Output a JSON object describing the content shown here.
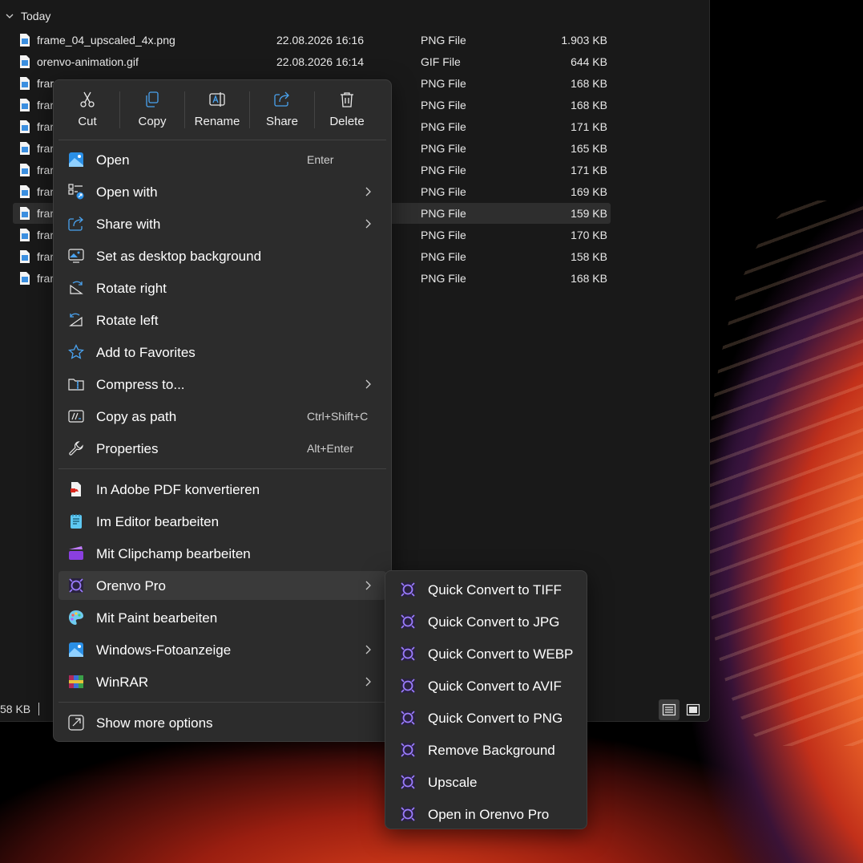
{
  "explorer": {
    "group_label": "Today",
    "files": [
      {
        "name": "frame_04_upscaled_4x.png",
        "date": "22.08.2026 16:16",
        "type": "PNG File",
        "size": "1.903 KB"
      },
      {
        "name": "orenvo-animation.gif",
        "date": "22.08.2026 16:14",
        "type": "GIF File",
        "size": "644 KB"
      },
      {
        "name": "frar",
        "date": "",
        "type": "PNG File",
        "size": "168 KB"
      },
      {
        "name": "frar",
        "date": "",
        "type": "PNG File",
        "size": "168 KB"
      },
      {
        "name": "frar",
        "date": "",
        "type": "PNG File",
        "size": "171 KB"
      },
      {
        "name": "frar",
        "date": "",
        "type": "PNG File",
        "size": "165 KB"
      },
      {
        "name": "frar",
        "date": "",
        "type": "PNG File",
        "size": "171 KB"
      },
      {
        "name": "frar",
        "date": "",
        "type": "PNG File",
        "size": "169 KB"
      },
      {
        "name": "frar",
        "date": "",
        "type": "PNG File",
        "size": "159 KB"
      },
      {
        "name": "frar",
        "date": "",
        "type": "PNG File",
        "size": "170 KB"
      },
      {
        "name": "frar",
        "date": "",
        "type": "PNG File",
        "size": "158 KB"
      },
      {
        "name": "frar",
        "date": "",
        "type": "PNG File",
        "size": "168 KB"
      }
    ],
    "status_size": "58 KB"
  },
  "context_menu": {
    "quick_actions": {
      "cut": "Cut",
      "copy": "Copy",
      "rename": "Rename",
      "share": "Share",
      "delete": "Delete"
    },
    "items": [
      {
        "label": "Open",
        "shortcut": "Enter"
      },
      {
        "label": "Open with",
        "shortcut": ""
      },
      {
        "label": "Share with",
        "shortcut": ""
      },
      {
        "label": "Set as desktop background",
        "shortcut": ""
      },
      {
        "label": "Rotate right",
        "shortcut": ""
      },
      {
        "label": "Rotate left",
        "shortcut": ""
      },
      {
        "label": "Add to Favorites",
        "shortcut": ""
      },
      {
        "label": "Compress to...",
        "shortcut": ""
      },
      {
        "label": "Copy as path",
        "shortcut": "Ctrl+Shift+C"
      },
      {
        "label": "Properties",
        "shortcut": "Alt+Enter"
      },
      {
        "label": "In Adobe PDF konvertieren",
        "shortcut": ""
      },
      {
        "label": "Im Editor bearbeiten",
        "shortcut": ""
      },
      {
        "label": "Mit Clipchamp bearbeiten",
        "shortcut": ""
      },
      {
        "label": "Orenvo Pro",
        "shortcut": ""
      },
      {
        "label": "Mit Paint bearbeiten",
        "shortcut": ""
      },
      {
        "label": "Windows-Fotoanzeige",
        "shortcut": ""
      },
      {
        "label": "WinRAR",
        "shortcut": ""
      },
      {
        "label": "Show more options",
        "shortcut": ""
      }
    ]
  },
  "submenu": {
    "items": [
      "Quick Convert to TIFF",
      "Quick Convert to JPG",
      "Quick Convert to WEBP",
      "Quick Convert to AVIF",
      "Quick Convert to PNG",
      "Remove Background",
      "Upscale",
      "Open in Orenvo Pro"
    ]
  },
  "colors": {
    "menu_bg": "#2c2c2c",
    "explorer_bg": "#191919",
    "accent_blue": "#4aa3f0",
    "orenvo_purple": "#7b5cff"
  }
}
